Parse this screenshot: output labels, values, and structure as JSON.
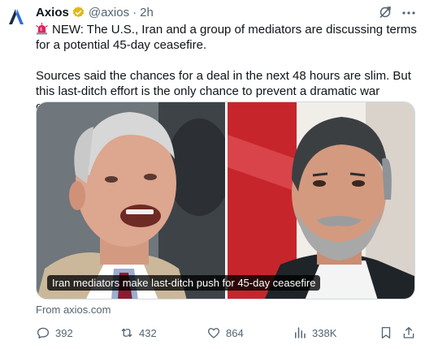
{
  "tweet": {
    "author_name": "Axios",
    "handle": "@axios",
    "separator": "·",
    "time": "2h",
    "paragraph_1": "NEW: The U.S., Iran and a group of mediators are discussing terms for a potential 45-day ceasefire.",
    "paragraph_2": "Sources said the chances for a deal in the next 48 hours are slim. But this last-ditch effort is the only chance to prevent a dramatic war escalation.",
    "media_caption": "Iran mediators make last-ditch push for 45-day ceasefire",
    "source_label": "From axios.com"
  },
  "actions": {
    "replies": "392",
    "reposts": "432",
    "likes": "864",
    "views": "338K"
  },
  "icons": {
    "avatar": "axios-logo-icon",
    "verified": "verified-badge-icon",
    "grok": "grok-icon",
    "more": "more-icon",
    "siren": "siren-emoji-icon",
    "reply": "reply-icon",
    "repost": "repost-icon",
    "like": "heart-icon",
    "views": "views-chart-icon",
    "bookmark": "bookmark-icon",
    "share": "share-icon"
  },
  "colors": {
    "text_primary": "#0f1419",
    "text_secondary": "#536471",
    "verified_gold": "#e2b719",
    "axios_blue": "#1a3a6e",
    "border": "#cfd9de"
  }
}
